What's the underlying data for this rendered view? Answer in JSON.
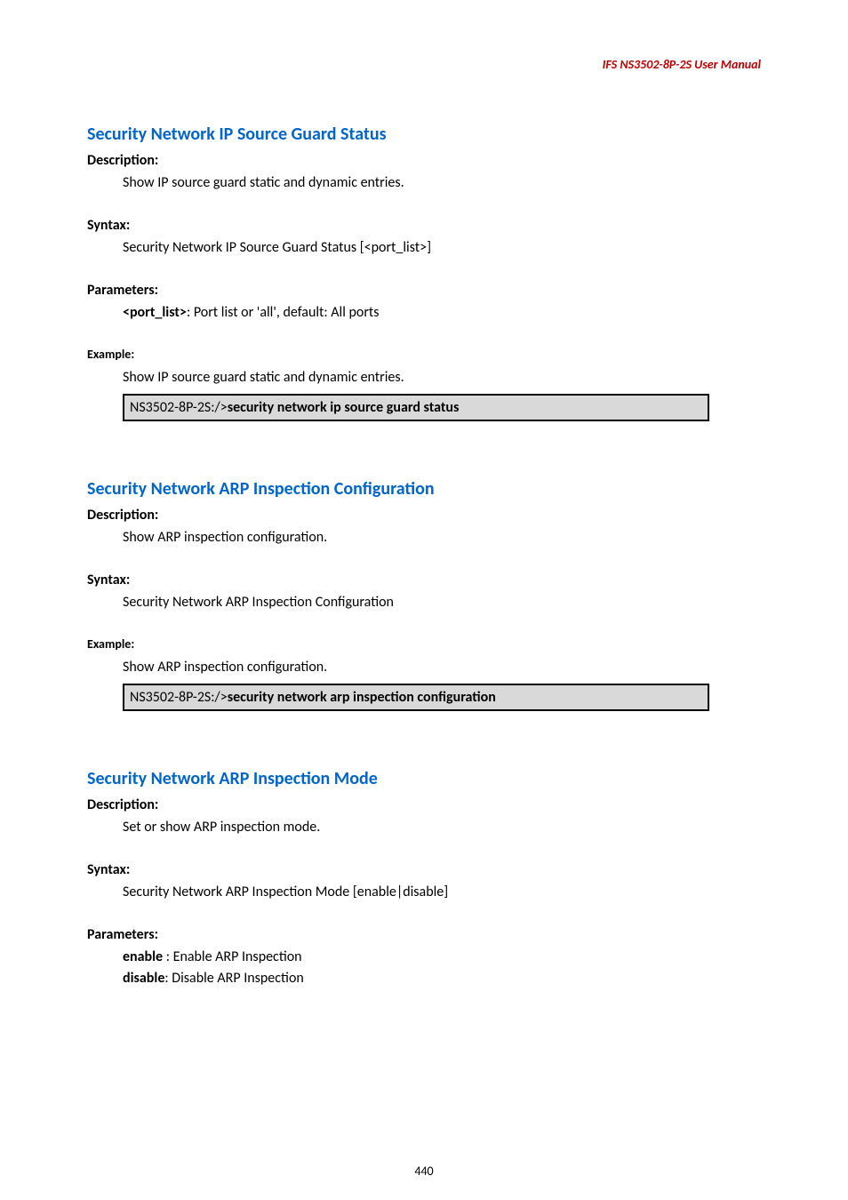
{
  "running_header": "IFS  NS3502-8P-2S  User  Manual",
  "page_number": "440",
  "section1": {
    "title": "Security Network IP Source Guard Status",
    "description_label": "Description:",
    "description_text": "Show IP source guard static and dynamic entries.",
    "syntax_label": "Syntax:",
    "syntax_text": "Security Network IP Source Guard Status [<port_list>]",
    "parameters_label": "Parameters:",
    "param1_name": "<port_list>",
    "param1_desc": ": Port list or 'all', default: All ports",
    "example_label": "Example:",
    "example_text": "Show IP source guard static and dynamic entries.",
    "code_prompt": "NS3502-8P-2S:/>",
    "code_cmd": "security network ip source guard status"
  },
  "section2": {
    "title": "Security Network ARP Inspection Configuration",
    "description_label": "Description:",
    "description_text": "Show ARP inspection configuration.",
    "syntax_label": "Syntax:",
    "syntax_text": "Security Network ARP Inspection Configuration",
    "example_label": "Example:",
    "example_text": "Show ARP inspection configuration.",
    "code_prompt": "NS3502-8P-2S:/>",
    "code_cmd": "security network arp inspection configuration"
  },
  "section3": {
    "title": "Security Network ARP Inspection Mode",
    "description_label": "Description:",
    "description_text": "Set or show ARP inspection mode.",
    "syntax_label": "Syntax:",
    "syntax_text": "Security Network ARP Inspection Mode [enable|disable]",
    "parameters_label": "Parameters:",
    "param1_name": "enable",
    "param1_desc": " : Enable ARP Inspection",
    "param2_name": "disable",
    "param2_desc": ": Disable ARP Inspection"
  }
}
